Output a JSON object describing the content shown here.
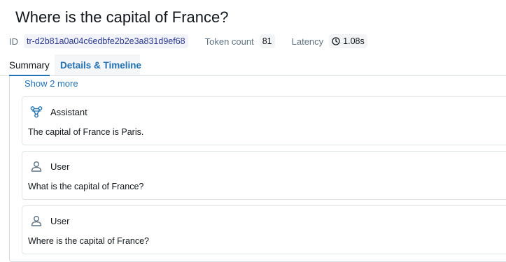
{
  "header": {
    "title": "Where is the capital of France?"
  },
  "meta": {
    "id_label": "ID",
    "id_value": "tr-d2b81a0a04c6edbfe2b2e3a831d9ef68",
    "token_label": "Token count",
    "token_value": "81",
    "latency_label": "Latency",
    "latency_value": "1.08s",
    "latency_icon": "clock-icon"
  },
  "tabs": [
    {
      "label": "Summary",
      "active": true
    },
    {
      "label": "Details & Timeline",
      "active": false
    }
  ],
  "conversation": {
    "show_more_label": "Show 2 more",
    "messages": [
      {
        "role": "Assistant",
        "icon": "assistant-icon",
        "text": "The capital of France is Paris."
      },
      {
        "role": "User",
        "icon": "user-icon",
        "text": "What is the capital of France?"
      },
      {
        "role": "User",
        "icon": "user-icon",
        "text": "Where is the capital of France?"
      }
    ]
  },
  "colors": {
    "accent": "#2272b4",
    "text": "#11171c",
    "muted": "#5f7281",
    "border": "#d9dee3"
  }
}
